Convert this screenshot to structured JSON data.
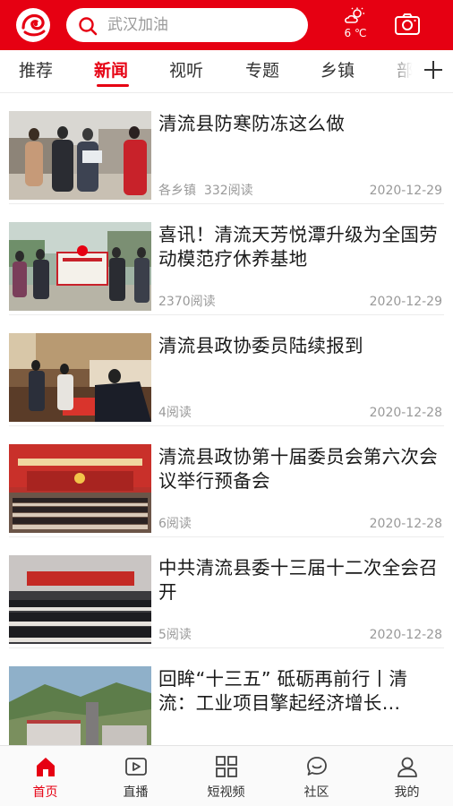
{
  "header": {
    "search_placeholder": "武汉加油",
    "weather_temp": "6 ℃",
    "brand_color": "#e60012",
    "icons": [
      "logo-icon",
      "search-icon",
      "weather-icon",
      "camera-icon"
    ]
  },
  "tabs": [
    {
      "label": "推荐",
      "active": false
    },
    {
      "label": "新闻",
      "active": true
    },
    {
      "label": "视听",
      "active": false
    },
    {
      "label": "专题",
      "active": false
    },
    {
      "label": "乡镇",
      "active": false
    },
    {
      "label": "部",
      "active": false
    }
  ],
  "news": [
    {
      "title": "清流县防寒防冻这么做",
      "source": "各乡镇",
      "reads": "332阅读",
      "date": "2020-12-29"
    },
    {
      "title": "喜讯！清流天芳悦潭升级为全国劳动模范疗休养基地",
      "source": "",
      "reads": "2370阅读",
      "date": "2020-12-29"
    },
    {
      "title": "清流县政协委员陆续报到",
      "source": "",
      "reads": "4阅读",
      "date": "2020-12-28"
    },
    {
      "title": "清流县政协第十届委员会第六次会议举行预备会",
      "source": "",
      "reads": "6阅读",
      "date": "2020-12-28"
    },
    {
      "title": "中共清流县委十三届十二次全会召开",
      "source": "",
      "reads": "5阅读",
      "date": "2020-12-28"
    },
    {
      "title": "回眸“十三五” 砥砺再前行丨清流：工业项目擎起经济增长…",
      "source": "",
      "reads": "",
      "date": ""
    }
  ],
  "bottom_nav": [
    {
      "label": "首页",
      "icon": "home-icon",
      "active": true
    },
    {
      "label": "直播",
      "icon": "play-icon",
      "active": false
    },
    {
      "label": "短视频",
      "icon": "grid-icon",
      "active": false
    },
    {
      "label": "社区",
      "icon": "chat-icon",
      "active": false
    },
    {
      "label": "我的",
      "icon": "user-icon",
      "active": false
    }
  ]
}
